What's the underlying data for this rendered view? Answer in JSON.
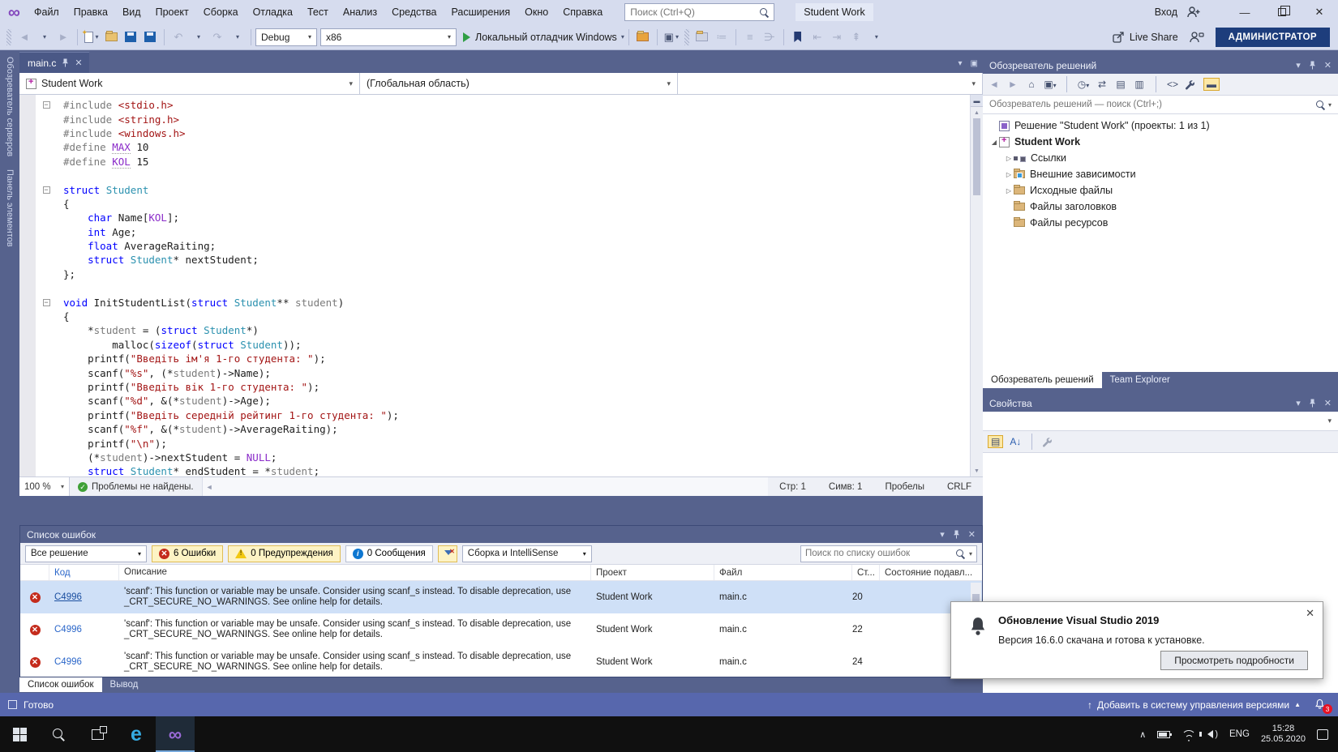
{
  "titlebar": {
    "menus": [
      "Файл",
      "Правка",
      "Вид",
      "Проект",
      "Сборка",
      "Отладка",
      "Тест",
      "Анализ",
      "Средства",
      "Расширения",
      "Окно",
      "Справка"
    ],
    "search_placeholder": "Поиск (Ctrl+Q)",
    "window_title": "Student Work",
    "sign_in": "Вход"
  },
  "toolbar": {
    "config": "Debug",
    "platform": "x86",
    "run": "Локальный отладчик Windows",
    "live_share": "Live Share",
    "admin": "АДМИНИСТРАТОР"
  },
  "side_tabs": [
    "Обозреватель серверов",
    "Панель элементов"
  ],
  "editor": {
    "tab": "main.c",
    "nav_project": "Student Work",
    "nav_scope": "(Глобальная область)",
    "zoom": "100 %",
    "health": "Проблемы не найдены.",
    "pos_line": "Стр: 1",
    "pos_char": "Симв: 1",
    "spaces": "Пробелы",
    "eol": "CRLF",
    "code_lines": [
      {
        "fold": true,
        "tokens": [
          [
            "pp",
            "#include "
          ],
          [
            "str",
            "<stdio.h>"
          ]
        ]
      },
      {
        "fold": false,
        "tokens": [
          [
            "pp",
            "#include "
          ],
          [
            "str",
            "<string.h>"
          ]
        ]
      },
      {
        "fold": false,
        "tokens": [
          [
            "pp",
            "#include "
          ],
          [
            "str",
            "<windows.h>"
          ]
        ]
      },
      {
        "fold": false,
        "tokens": [
          [
            "pp",
            "#define "
          ],
          [
            "macd",
            "MAX"
          ],
          [
            "df",
            " "
          ],
          [
            "num",
            "10"
          ]
        ]
      },
      {
        "fold": false,
        "tokens": [
          [
            "pp",
            "#define "
          ],
          [
            "macd",
            "KOL"
          ],
          [
            "df",
            " "
          ],
          [
            "num",
            "15"
          ]
        ]
      },
      {
        "fold": false,
        "tokens": []
      },
      {
        "fold": true,
        "tokens": [
          [
            "kw",
            "struct "
          ],
          [
            "ty",
            "Student"
          ]
        ]
      },
      {
        "fold": false,
        "tokens": [
          [
            "df",
            "{"
          ]
        ]
      },
      {
        "fold": false,
        "tokens": [
          [
            "df",
            "    "
          ],
          [
            "kw",
            "char"
          ],
          [
            "df",
            " Name["
          ],
          [
            "mac",
            "KOL"
          ],
          [
            "df",
            "];"
          ]
        ]
      },
      {
        "fold": false,
        "tokens": [
          [
            "df",
            "    "
          ],
          [
            "kw",
            "int"
          ],
          [
            "df",
            " Age;"
          ]
        ]
      },
      {
        "fold": false,
        "tokens": [
          [
            "df",
            "    "
          ],
          [
            "kw",
            "float"
          ],
          [
            "df",
            " AverageRaiting;"
          ]
        ]
      },
      {
        "fold": false,
        "tokens": [
          [
            "df",
            "    "
          ],
          [
            "kw",
            "struct "
          ],
          [
            "ty",
            "Student"
          ],
          [
            "df",
            "* nextStudent;"
          ]
        ]
      },
      {
        "fold": false,
        "tokens": [
          [
            "df",
            "};"
          ]
        ]
      },
      {
        "fold": false,
        "tokens": []
      },
      {
        "fold": true,
        "tokens": [
          [
            "kw",
            "void"
          ],
          [
            "df",
            " InitStudentList("
          ],
          [
            "kw",
            "struct "
          ],
          [
            "ty",
            "Student"
          ],
          [
            "df",
            "** "
          ],
          [
            "gy",
            "student"
          ],
          [
            "df",
            ")"
          ]
        ]
      },
      {
        "fold": false,
        "tokens": [
          [
            "df",
            "{"
          ]
        ]
      },
      {
        "fold": false,
        "tokens": [
          [
            "df",
            "    *"
          ],
          [
            "gy",
            "student"
          ],
          [
            "df",
            " = ("
          ],
          [
            "kw",
            "struct "
          ],
          [
            "ty",
            "Student"
          ],
          [
            "df",
            "*)"
          ]
        ]
      },
      {
        "fold": false,
        "tokens": [
          [
            "df",
            "        malloc("
          ],
          [
            "kw",
            "sizeof"
          ],
          [
            "df",
            "("
          ],
          [
            "kw",
            "struct "
          ],
          [
            "ty",
            "Student"
          ],
          [
            "df",
            "));"
          ]
        ]
      },
      {
        "fold": false,
        "tokens": [
          [
            "df",
            "    printf("
          ],
          [
            "str",
            "\"Введіть ім'я 1-го студента: \""
          ],
          [
            "df",
            ");"
          ]
        ]
      },
      {
        "fold": false,
        "tokens": [
          [
            "df",
            "    scanf("
          ],
          [
            "str",
            "\"%s\""
          ],
          [
            "df",
            ", (*"
          ],
          [
            "gy",
            "student"
          ],
          [
            "df",
            ")->Name);"
          ]
        ]
      },
      {
        "fold": false,
        "tokens": [
          [
            "df",
            "    printf("
          ],
          [
            "str",
            "\"Введіть вік 1-го студента: \""
          ],
          [
            "df",
            ");"
          ]
        ]
      },
      {
        "fold": false,
        "tokens": [
          [
            "df",
            "    scanf("
          ],
          [
            "str",
            "\"%d\""
          ],
          [
            "df",
            ", &(*"
          ],
          [
            "gy",
            "student"
          ],
          [
            "df",
            ")->Age);"
          ]
        ]
      },
      {
        "fold": false,
        "tokens": [
          [
            "df",
            "    printf("
          ],
          [
            "str",
            "\"Введіть середній рейтинг 1-го студента: \""
          ],
          [
            "df",
            ");"
          ]
        ]
      },
      {
        "fold": false,
        "tokens": [
          [
            "df",
            "    scanf("
          ],
          [
            "str",
            "\"%f\""
          ],
          [
            "df",
            ", &(*"
          ],
          [
            "gy",
            "student"
          ],
          [
            "df",
            ")->AverageRaiting);"
          ]
        ]
      },
      {
        "fold": false,
        "tokens": [
          [
            "df",
            "    printf("
          ],
          [
            "str",
            "\"\\n\""
          ],
          [
            "df",
            ");"
          ]
        ]
      },
      {
        "fold": false,
        "tokens": [
          [
            "df",
            "    (*"
          ],
          [
            "gy",
            "student"
          ],
          [
            "df",
            ")->nextStudent = "
          ],
          [
            "mac",
            "NULL"
          ],
          [
            "df",
            ";"
          ]
        ]
      },
      {
        "fold": false,
        "tokens": [
          [
            "df",
            "    "
          ],
          [
            "kw",
            "struct "
          ],
          [
            "ty",
            "Student"
          ],
          [
            "df",
            "* endStudent = *"
          ],
          [
            "gy",
            "student"
          ],
          [
            "df",
            ";"
          ]
        ]
      }
    ]
  },
  "solution_explorer": {
    "title": "Обозреватель решений",
    "search_placeholder": "Обозреватель решений — поиск (Ctrl+;)",
    "tree": [
      {
        "label": "Решение \"Student Work\" (проекты: 1 из 1)",
        "depth": 0,
        "icon": "solution",
        "exp": "none",
        "bold": false
      },
      {
        "label": "Student Work",
        "depth": 0,
        "icon": "project",
        "exp": "expanded",
        "bold": true
      },
      {
        "label": "Ссылки",
        "depth": 1,
        "icon": "references",
        "exp": "collapsed",
        "bold": false
      },
      {
        "label": "Внешние зависимости",
        "depth": 1,
        "icon": "folder-deps",
        "exp": "collapsed",
        "bold": false
      },
      {
        "label": "Исходные файлы",
        "depth": 1,
        "icon": "folder-src",
        "exp": "collapsed",
        "bold": false
      },
      {
        "label": "Файлы заголовков",
        "depth": 1,
        "icon": "folder",
        "exp": "none",
        "bold": false
      },
      {
        "label": "Файлы ресурсов",
        "depth": 1,
        "icon": "folder",
        "exp": "none",
        "bold": false
      }
    ],
    "tabs": [
      "Обозреватель решений",
      "Team Explorer"
    ]
  },
  "properties": {
    "title": "Свойства"
  },
  "error_list": {
    "title": "Список ошибок",
    "scope": "Все решение",
    "errors": "6 Ошибки",
    "warnings": "0 Предупреждения",
    "messages": "0 Сообщения",
    "build_filter": "Сборка и IntelliSense",
    "search_placeholder": "Поиск по списку ошибок",
    "columns": {
      "code": "Код",
      "description": "Описание",
      "project": "Проект",
      "file": "Файл",
      "line": "Ст...",
      "suppression": "Состояние подавл..."
    },
    "rows": [
      {
        "code": "C4996",
        "description": "'scanf': This function or variable may be unsafe. Consider using scanf_s instead. To disable deprecation, use _CRT_SECURE_NO_WARNINGS. See online help for details.",
        "project": "Student Work",
        "file": "main.c",
        "line": "20",
        "selected": true
      },
      {
        "code": "C4996",
        "description": "'scanf': This function or variable may be unsafe. Consider using scanf_s instead. To disable deprecation, use _CRT_SECURE_NO_WARNINGS. See online help for details.",
        "project": "Student Work",
        "file": "main.c",
        "line": "22",
        "selected": false
      },
      {
        "code": "C4996",
        "description": "'scanf': This function or variable may be unsafe. Consider using scanf_s instead. To disable deprecation, use _CRT_SECURE_NO_WARNINGS. See online help for details.",
        "project": "Student Work",
        "file": "main.c",
        "line": "24",
        "selected": false
      }
    ],
    "tabs": [
      "Список ошибок",
      "Вывод"
    ]
  },
  "notification": {
    "title": "Обновление Visual Studio 2019",
    "body": "Версия 16.6.0 скачана и готова к установке.",
    "button": "Просмотреть подробности"
  },
  "status_bar": {
    "ready": "Готово",
    "vcs": "Добавить в систему управления версиями",
    "notif_count": "3"
  },
  "taskbar": {
    "lang": "ENG",
    "time": "15:28",
    "date": "25.05.2020"
  },
  "colors": {
    "workspace": "#56628d",
    "statusbar": "#5767ad",
    "error": "#c42b1c",
    "warning": "#f2c811",
    "info": "#0e77d1",
    "admin_badge": "#1d3d7c"
  }
}
